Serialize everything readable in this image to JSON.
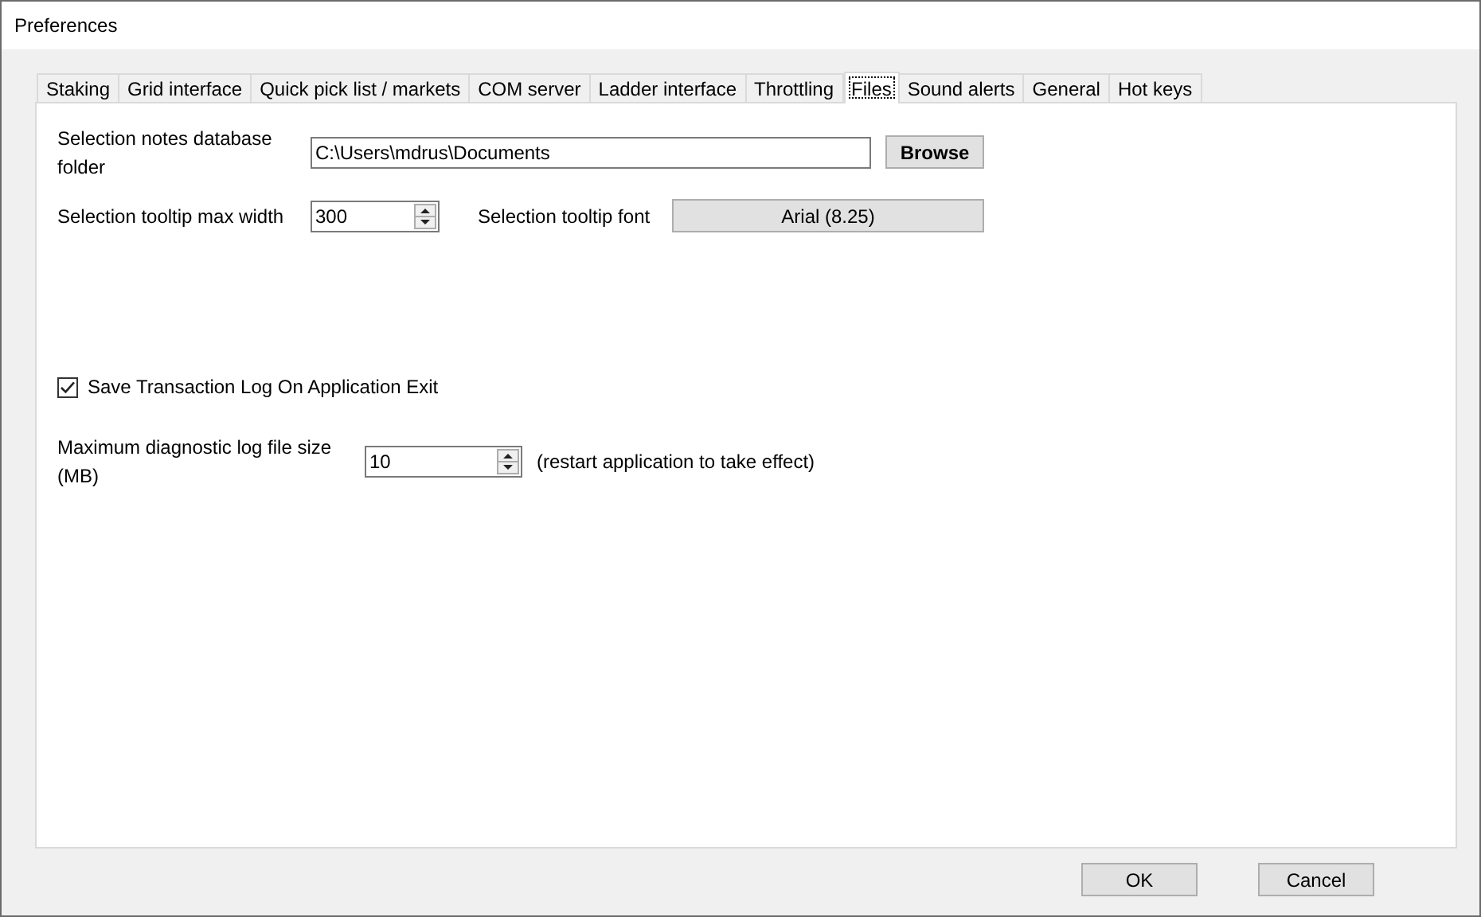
{
  "window": {
    "title": "Preferences"
  },
  "tabs": [
    {
      "label": "Staking",
      "selected": false
    },
    {
      "label": "Grid interface",
      "selected": false
    },
    {
      "label": "Quick pick list / markets",
      "selected": false
    },
    {
      "label": "COM server",
      "selected": false
    },
    {
      "label": "Ladder interface",
      "selected": false
    },
    {
      "label": "Throttling",
      "selected": false
    },
    {
      "label": "Files",
      "selected": true
    },
    {
      "label": "Sound alerts",
      "selected": false
    },
    {
      "label": "General",
      "selected": false
    },
    {
      "label": "Hot keys",
      "selected": false
    }
  ],
  "notes_folder": {
    "label": "Selection notes database folder",
    "value": "C:\\Users\\mdrus\\Documents",
    "button": "Browse"
  },
  "tooltip_width": {
    "label": "Selection tooltip max width",
    "value": "300"
  },
  "tooltip_font": {
    "label": "Selection tooltip font",
    "button": "Arial (8.25)"
  },
  "save_log": {
    "label": "Save Transaction Log On Application Exit",
    "checked": true
  },
  "log_size": {
    "label": "Maximum diagnostic log file size (MB)",
    "value": "10",
    "note": "(restart application to take effect)"
  },
  "buttons": [
    "OK",
    "Cancel"
  ]
}
